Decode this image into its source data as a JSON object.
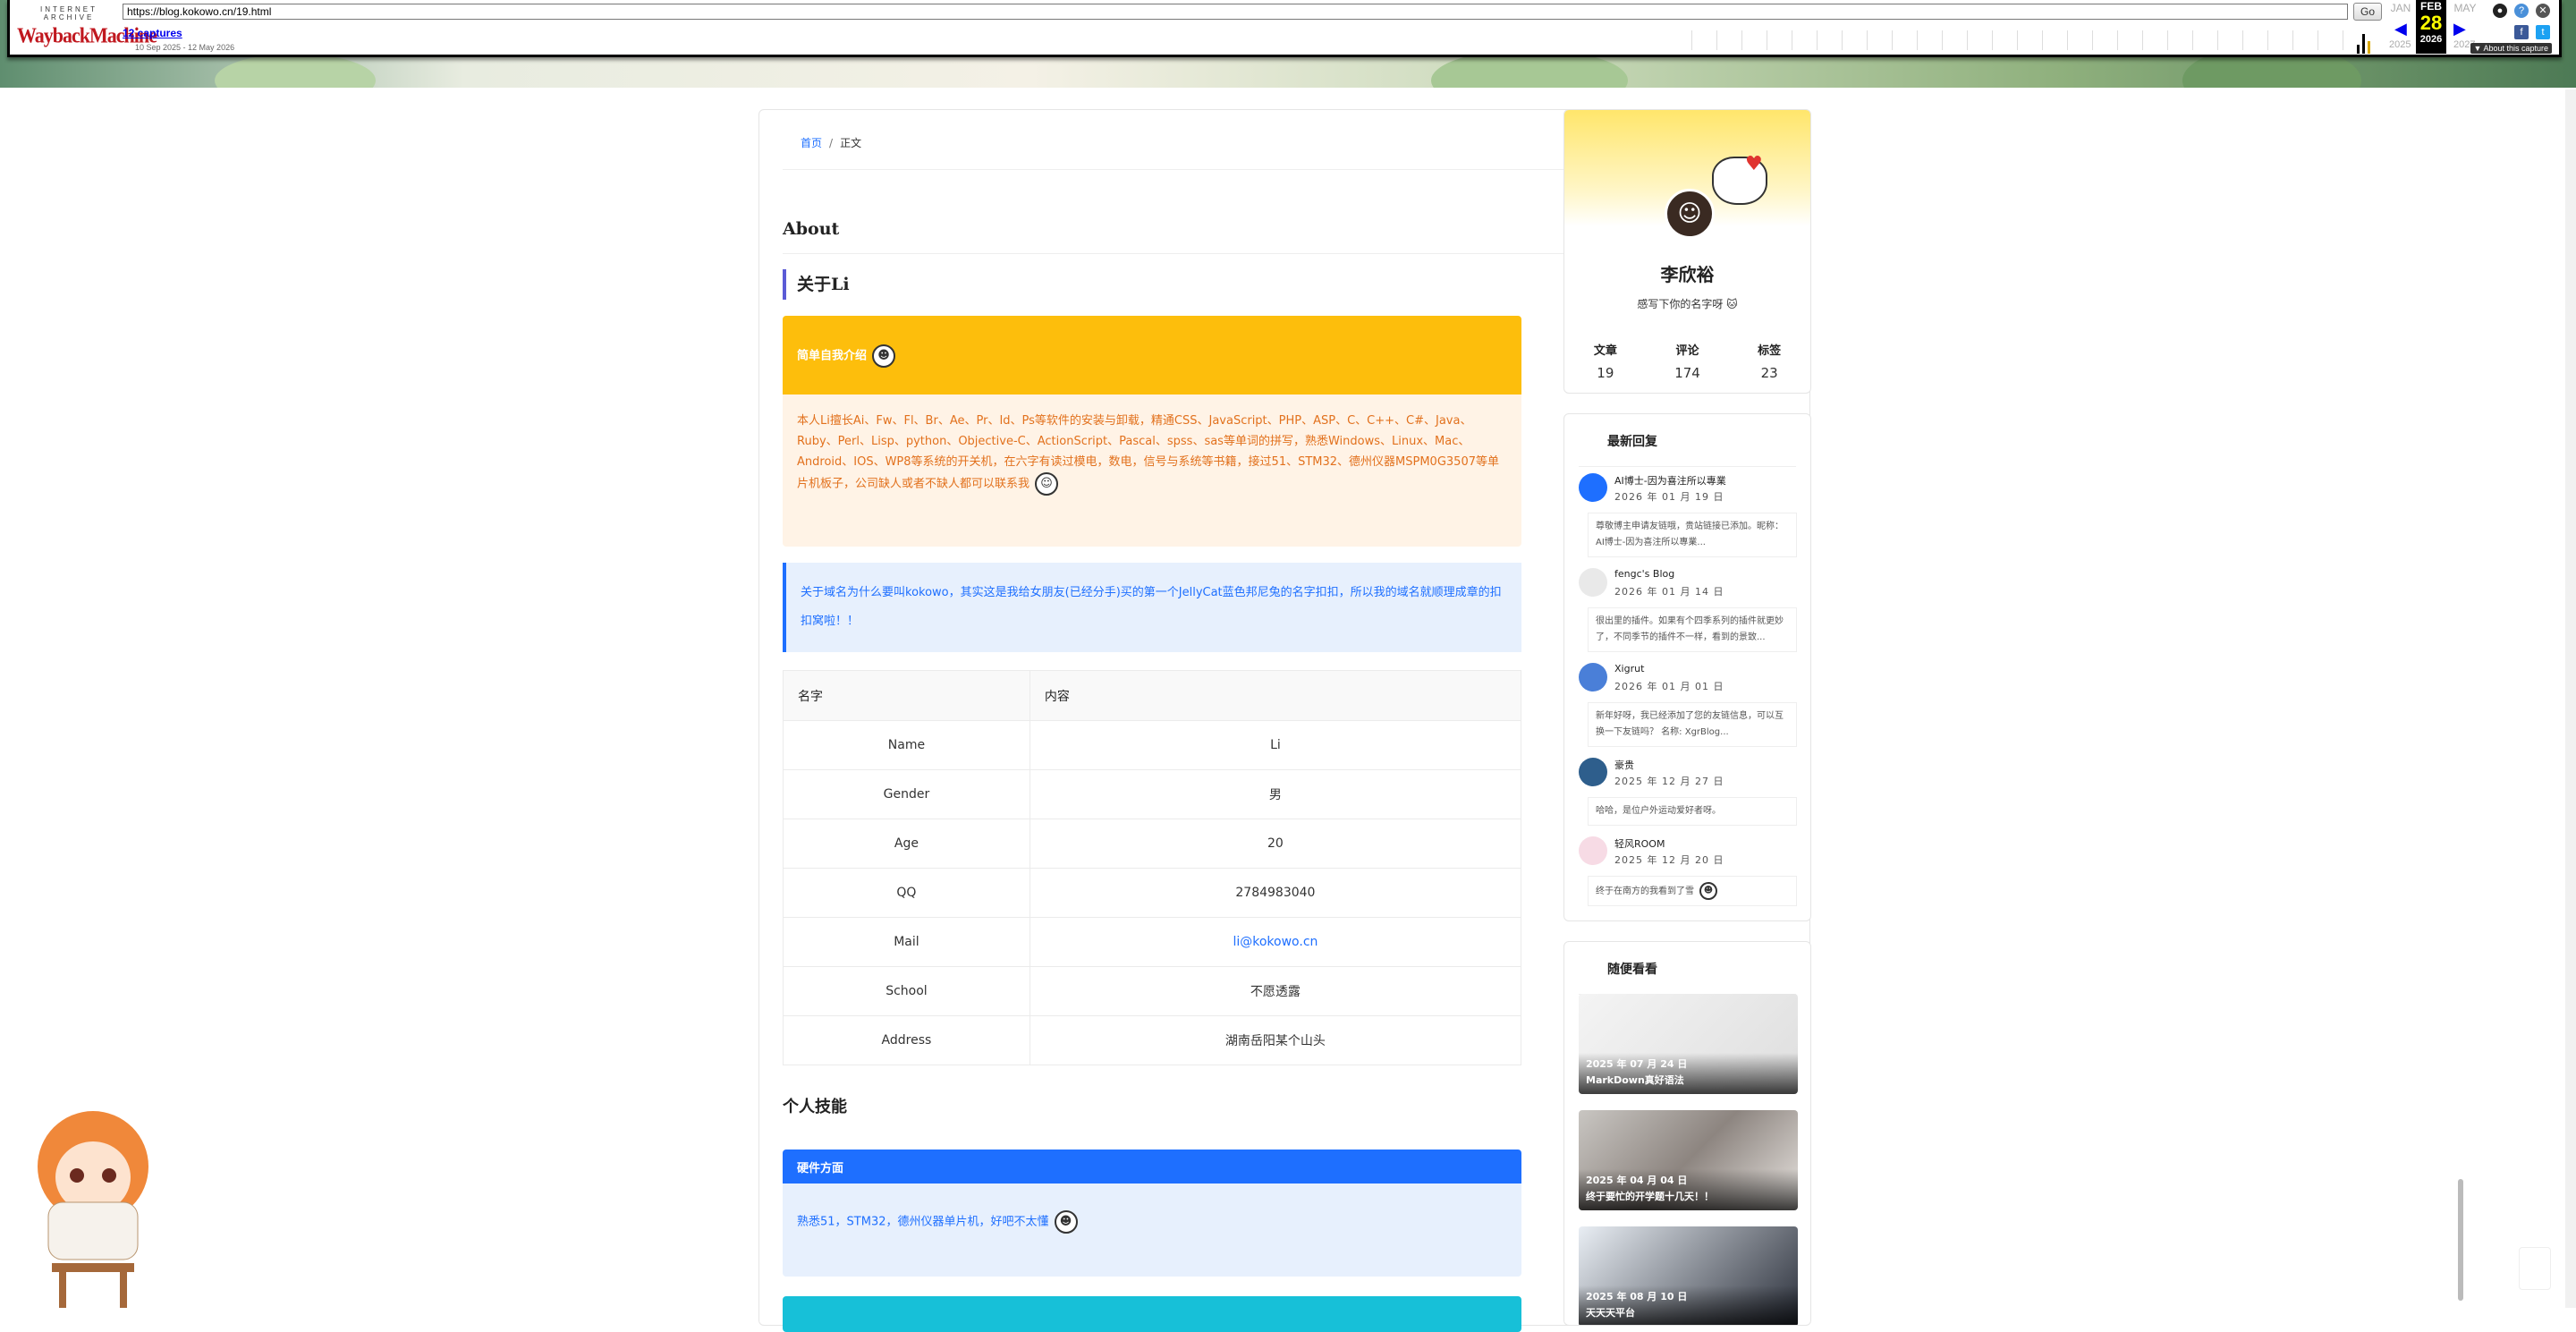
{
  "wayback": {
    "logo_top": "INTERNET ARCHIVE",
    "logo_main": "WaybackMachine",
    "url": "https://blog.kokowo.cn/19.html",
    "go_label": "Go",
    "captures": "12 captures",
    "range": "10 Sep 2025 - 12 May 2026",
    "prev_month": "JAN",
    "cur_month": "FEB",
    "cur_day": "28",
    "cur_year": "2026",
    "next_month": "MAY",
    "prev_year": "2025",
    "next_year": "2027",
    "about": "▼ About this capture"
  },
  "breadcrumb": {
    "home": "首页",
    "sep": "/",
    "current": "正文"
  },
  "page": {
    "title": "About",
    "section_title": "关于Li",
    "intro_header": "简单自我介绍",
    "intro_body": "本人Li擅长Ai、Fw、Fl、Br、Ae、Pr、Id、Ps等软件的安装与卸载，精通CSS、JavaScript、PHP、ASP、C、C++、C#、Java、Ruby、Perl、Lisp、python、Objective-C、ActionScript、Pascal、spss、sas等单词的拼写，熟悉Windows、Linux、Mac、Android、IOS、WP8等系统的开关机，在六字有读过模电，数电，信号与系统等书籍，接过51、STM32、德州仪器MSPM0G3507等单片机板子，公司缺人或者不缺人都可以联系我",
    "domain_note": "关于域名为什么要叫kokowo，其实这是我给女朋友(已经分手)买的第一个JellyCat蓝色邦尼兔的名字扣扣，所以我的域名就顺理成章的扣扣窝啦！！",
    "table_headers": [
      "名字",
      "内容"
    ],
    "table_rows": [
      {
        "k": "Name",
        "v": "Li"
      },
      {
        "k": "Gender",
        "v": "男"
      },
      {
        "k": "Age",
        "v": "20"
      },
      {
        "k": "QQ",
        "v": "2784983040"
      },
      {
        "k": "Mail",
        "v": "li@kokowo.cn"
      },
      {
        "k": "School",
        "v": "不愿透露"
      },
      {
        "k": "Address",
        "v": "湖南岳阳某个山头"
      }
    ],
    "skills_title": "个人技能",
    "hardware_header": "硬件方面",
    "hardware_body": "熟悉51，STM32，德州仪器单片机，好吧不太懂"
  },
  "profile": {
    "name": "李欣裕",
    "motto": "感写下你的名字呀 🐱",
    "stats": [
      {
        "label": "文章",
        "value": "19"
      },
      {
        "label": "评论",
        "value": "174"
      },
      {
        "label": "标签",
        "value": "23"
      }
    ]
  },
  "recent": {
    "title": "最新回复",
    "items": [
      {
        "name": "AI博士-因为喜注所以專業",
        "date": "2026 年 01 月 19 日",
        "comment": "尊敬博主申请友链哦，贵站链接已添加。昵称：AI博士-因为喜注所以專業..."
      },
      {
        "name": "fengc's Blog",
        "date": "2026 年 01 月 14 日",
        "comment": "很出里的插件。如果有个四季系列的插件就更妙了，不同季节的插件不一样，看到的景致..."
      },
      {
        "name": "Xigrut",
        "date": "2026 年 01 月 01 日",
        "comment": "新年好呀，我已经添加了您的友链信息，可以互换一下友链吗？ 名称: XgrBlog..."
      },
      {
        "name": "豪贵",
        "date": "2025 年 12 月 27 日",
        "comment": "哈哈，是位户外运动爱好者呀。"
      },
      {
        "name": "轻风ROOM",
        "date": "2025 年 12 月 20 日",
        "comment": "终于在南方的我看到了雪"
      }
    ]
  },
  "random": {
    "title": "随便看看",
    "posts": [
      {
        "date": "2025 年 07 月 24 日",
        "title": "MarkDown真好语法"
      },
      {
        "date": "2025 年 04 月 04 日",
        "title": "终于要忙的开学题十几天！！"
      },
      {
        "date": "2025 年 08 月 10 日",
        "title": "天天天平台"
      }
    ]
  },
  "colors": {
    "accent": "#1e6fff",
    "yellow": "#fdbe0c",
    "orange_text": "#e2711d",
    "cyan": "#17c0d8"
  },
  "icons": [
    "search-icon",
    "help-icon",
    "close-icon",
    "facebook-icon",
    "twitter-icon",
    "user-icon"
  ]
}
